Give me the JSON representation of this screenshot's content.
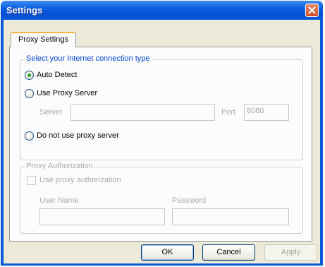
{
  "window": {
    "title": "Settings"
  },
  "tab": {
    "label": "Proxy Settings"
  },
  "connection": {
    "legend": "Select your Internet connection type",
    "auto_detect": "Auto Detect",
    "use_proxy": "Use Proxy Server",
    "server_label": "Server",
    "server_value": "",
    "port_label": "Port",
    "port_value": "8080",
    "no_proxy": "Do not use proxy server",
    "selected": "auto_detect"
  },
  "auth": {
    "legend": "Proxy Authorization",
    "use_auth": "Use proxy authorization",
    "username_label": "User Name",
    "username_value": "",
    "password_label": "Password",
    "password_value": ""
  },
  "buttons": {
    "ok": "OK",
    "cancel": "Cancel",
    "apply": "Apply"
  },
  "icons": {
    "close": "close-icon"
  },
  "colors": {
    "title_bar": "#0550d4",
    "accent_legend": "#0046d5",
    "radio_check": "#21a121",
    "close": "#d14a24"
  }
}
